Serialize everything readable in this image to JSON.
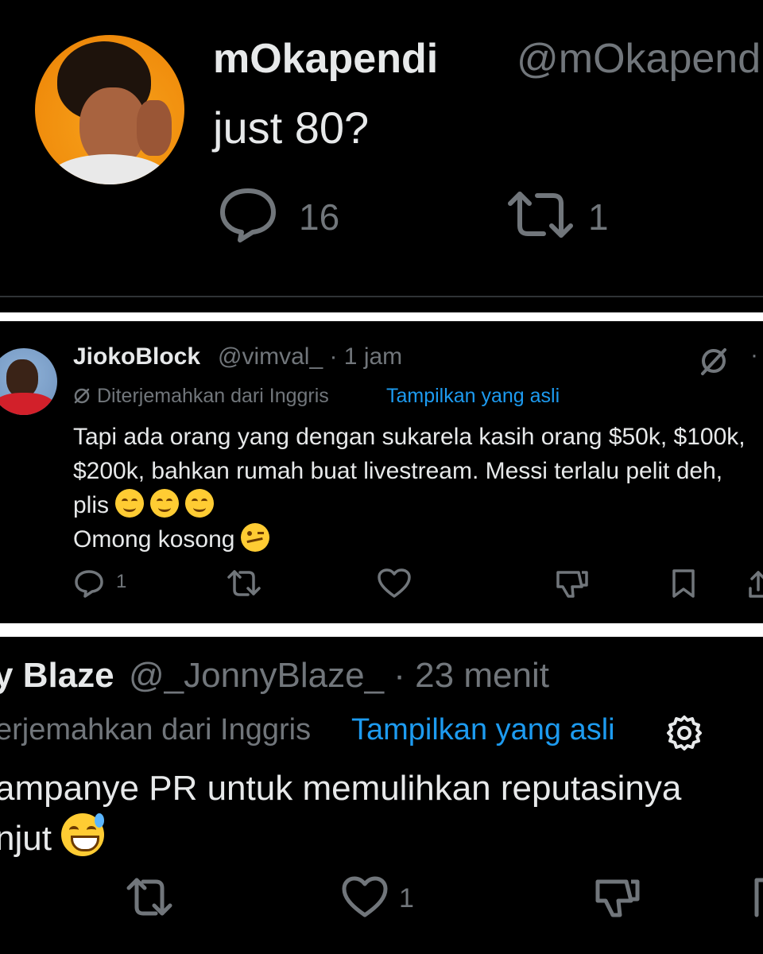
{
  "tweets": [
    {
      "display_name": "mOkapendi",
      "handle": "@mOkapendi",
      "text": "just 80?",
      "reply_count": "16",
      "repost_count": "1",
      "icons": [
        "reply-icon",
        "repost-icon"
      ]
    },
    {
      "display_name": "JiokoBlock",
      "meta": "@vimval_ · 1 jam",
      "translated_label": "Diterjemahkan dari Inggris",
      "show_original": "Tampilkan yang asli",
      "lines": [
        "Tapi ada orang yang dengan sukarela kasih orang $50k, $100k, $200k, bahkan rumah buat livestream. Messi terlalu pelit deh, plis",
        "Omong kosong"
      ],
      "reply_count": "1",
      "icons": [
        "grok-icon",
        "more-icon",
        "reply-icon",
        "repost-icon",
        "like-icon",
        "dislike-icon",
        "bookmark-icon",
        "share-icon",
        "smiling-face-emoji",
        "woozy-face-emoji"
      ]
    },
    {
      "display_name": "y Blaze",
      "meta": "@_JonnyBlaze_ · 23 menit",
      "translated_label": "erjemahkan dari Inggris",
      "show_original": "Tampilkan yang asli",
      "lines": [
        "ampanye PR untuk memulihkan reputasinya",
        "njut"
      ],
      "like_count": "1",
      "icons": [
        "settings-icon",
        "repost-icon",
        "like-icon",
        "dislike-icon",
        "bookmark-icon",
        "sweat-smile-emoji"
      ]
    }
  ],
  "colors": {
    "background": "#000000",
    "text": "#e7e9ea",
    "muted": "#71767b",
    "link": "#1d9bf0",
    "separator": "#ffffff"
  }
}
